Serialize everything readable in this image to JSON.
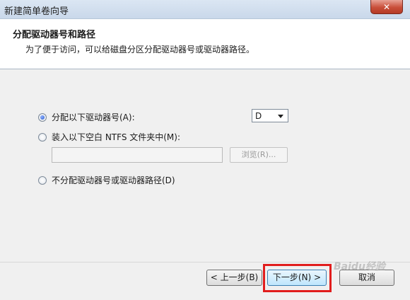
{
  "window": {
    "title": "新建简单卷向导"
  },
  "header": {
    "title": "分配驱动器号和路径",
    "subtitle": "为了便于访问，可以给磁盘分区分配驱动器号或驱动器路径。"
  },
  "options": {
    "assign_letter": {
      "label": "分配以下驱动器号(A):",
      "selected": true
    },
    "mount_folder": {
      "label": "装入以下空白 NTFS 文件夹中(M):",
      "selected": false
    },
    "no_assign": {
      "label": "不分配驱动器号或驱动器路径(D)",
      "selected": false
    }
  },
  "drive_letter": {
    "value": "D"
  },
  "folder_path": {
    "value": ""
  },
  "browse_button": {
    "label": "浏览(R)..."
  },
  "buttons": {
    "back": "< 上一步(B)",
    "next": "下一步(N) >",
    "cancel": "取消"
  },
  "watermark": {
    "text": "Baidu经验"
  },
  "colors": {
    "highlight": "#e11d1d",
    "close_button": "#c94f3a"
  }
}
